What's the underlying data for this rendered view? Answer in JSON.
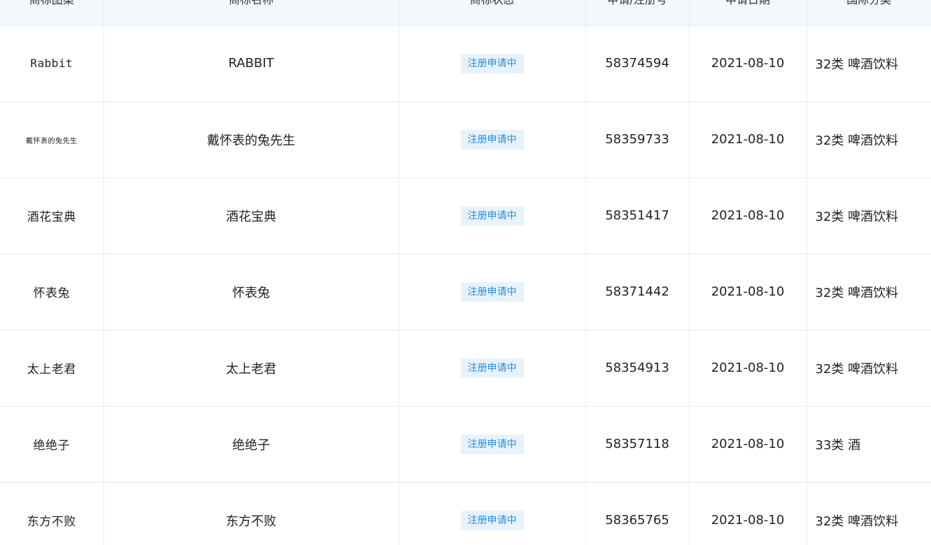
{
  "columns": {
    "logo": "商标图案",
    "name": "商标名称",
    "status": "商标状态",
    "reg_no": "申请/注册号",
    "date": "申请日期",
    "class": "国际分类"
  },
  "rows": [
    {
      "logo": "Rabbit",
      "name": "RABBIT",
      "status": "注册申请中",
      "reg_no": "58374594",
      "date": "2021-08-10",
      "class": "32类 啤酒饮料"
    },
    {
      "logo": "戴怀表的兔先生",
      "name": "戴怀表的兔先生",
      "status": "注册申请中",
      "reg_no": "58359733",
      "date": "2021-08-10",
      "class": "32类 啤酒饮料"
    },
    {
      "logo": "酒花宝典",
      "name": "酒花宝典",
      "status": "注册申请中",
      "reg_no": "58351417",
      "date": "2021-08-10",
      "class": "32类 啤酒饮料"
    },
    {
      "logo": "怀表兔",
      "name": "怀表兔",
      "status": "注册申请中",
      "reg_no": "58371442",
      "date": "2021-08-10",
      "class": "32类 啤酒饮料"
    },
    {
      "logo": "太上老君",
      "name": "太上老君",
      "status": "注册申请中",
      "reg_no": "58354913",
      "date": "2021-08-10",
      "class": "32类 啤酒饮料"
    },
    {
      "logo": "绝绝子",
      "name": "绝绝子",
      "status": "注册申请中",
      "reg_no": "58357118",
      "date": "2021-08-10",
      "class": "33类 酒"
    },
    {
      "logo": "东方不败",
      "name": "东方不败",
      "status": "注册申请中",
      "reg_no": "58365765",
      "date": "2021-08-10",
      "class": "32类 啤酒饮料"
    }
  ]
}
